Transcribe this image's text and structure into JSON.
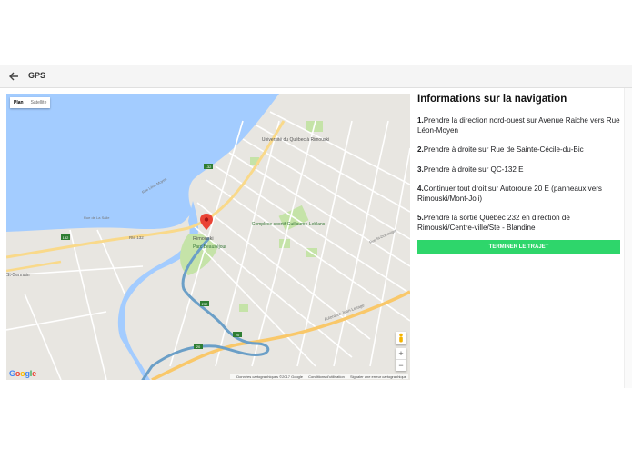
{
  "appbar": {
    "back_icon": "arrow-left-icon",
    "title": "GPS"
  },
  "map": {
    "map_types": [
      "Plan",
      "Satellite"
    ],
    "active_map_type": "Plan",
    "labels": {
      "university": "Université du Québec à Rimouski",
      "complex": "Complexe sportif Guillaume-Leblanc",
      "park": "Parc Beauséjour",
      "city": "Rimouski",
      "r132": "132",
      "r20": "20",
      "r232": "232",
      "route132": "Rte 132",
      "germain": "St-Germain",
      "lasalle": "Rue de La Salle",
      "leon": "Rue Léon-Moyen",
      "autoroute": "Autoroute Jean-Lesage",
      "dominique": "Rue St-Dominique"
    },
    "zoom_in": "+",
    "zoom_out": "−",
    "brand": "Google",
    "attribution": {
      "data": "Données cartographiques ©2017 Google",
      "terms": "Conditions d'utilisation",
      "report": "Signaler une erreur cartographique"
    },
    "colors": {
      "water": "#a3ccff",
      "land": "#e8e6e1",
      "park": "#c5e3a8",
      "route": "#6b9fc7",
      "highway": "#f9c86a",
      "pin": "#ea4335"
    }
  },
  "panel": {
    "title": "Informations sur la navigation",
    "steps": [
      {
        "num": "1.",
        "text": "Prendre la direction nord-ouest sur Avenue Raiche vers Rue Léon-Moyen"
      },
      {
        "num": "2.",
        "text": "Prendre à droite sur Rue de Sainte-Cécile-du-Bic"
      },
      {
        "num": "3.",
        "text": "Prendre à droite sur QC-132 E"
      },
      {
        "num": "4.",
        "text": "Continuer tout droit sur Autoroute 20 E (panneaux vers Rimouski/Mont-Joli)"
      },
      {
        "num": "5.",
        "text": "Prendre la sortie Québec 232 en direction de Rimouski/Centre-ville/Ste - Blandine"
      }
    ],
    "end_button": "TERMINER LE TRAJET",
    "end_button_color": "#2ed66b"
  }
}
